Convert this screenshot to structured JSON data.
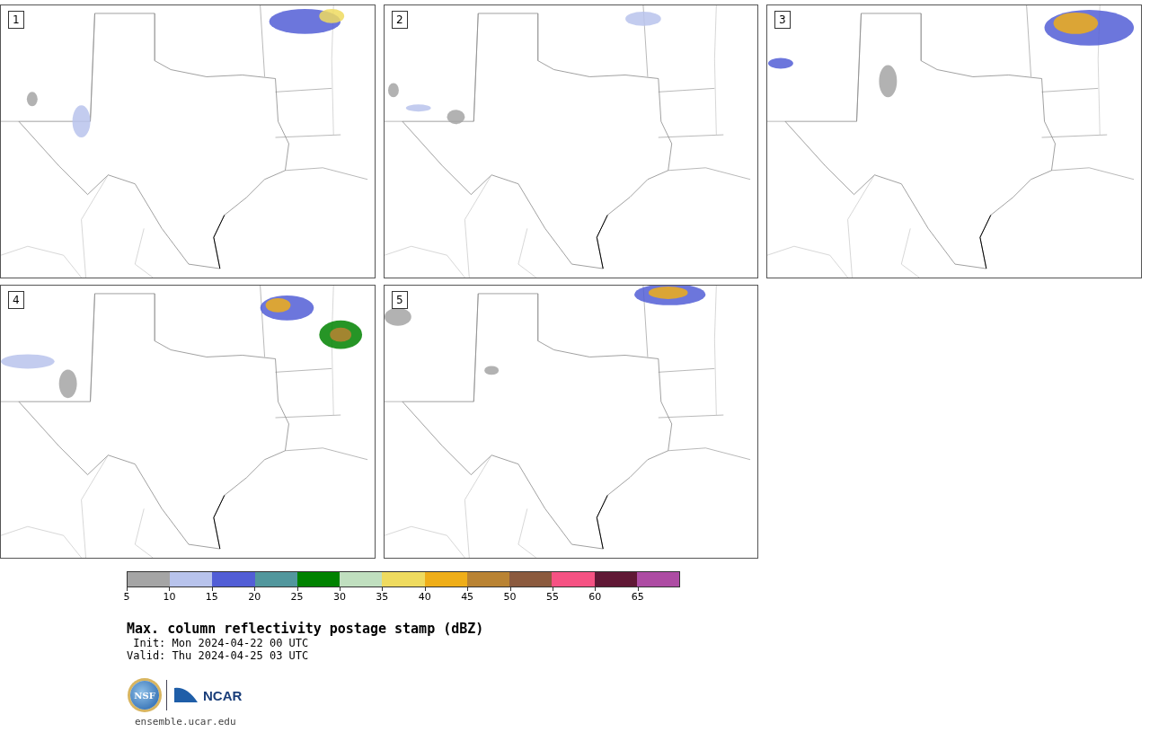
{
  "panels": [
    {
      "number": "1"
    },
    {
      "number": "2"
    },
    {
      "number": "3"
    },
    {
      "number": "4"
    },
    {
      "number": "5"
    }
  ],
  "colorbar": {
    "segments": [
      {
        "label": "5",
        "color": "#a5a5a5"
      },
      {
        "label": "10",
        "color": "#b8c3ec"
      },
      {
        "label": "15",
        "color": "#525ed6"
      },
      {
        "label": "20",
        "color": "#52979d"
      },
      {
        "label": "25",
        "color": "#008200"
      },
      {
        "label": "30",
        "color": "#c0dfbf"
      },
      {
        "label": "35",
        "color": "#efdb5f"
      },
      {
        "label": "40",
        "color": "#efae19"
      },
      {
        "label": "45",
        "color": "#b98333"
      },
      {
        "label": "50",
        "color": "#8b5a3e"
      },
      {
        "label": "55",
        "color": "#f55283"
      },
      {
        "label": "60",
        "color": "#601835"
      },
      {
        "label": "65",
        "color": "#ad4ca3"
      }
    ]
  },
  "title": "Max. column reflectivity postage stamp (dBZ)",
  "init": " Init: Mon 2024-04-22 00 UTC",
  "valid": "Valid: Thu 2024-04-25 03 UTC",
  "logos": {
    "nsf": "NSF",
    "ncar": "NCAR"
  },
  "footer": "ensemble.ucar.edu"
}
